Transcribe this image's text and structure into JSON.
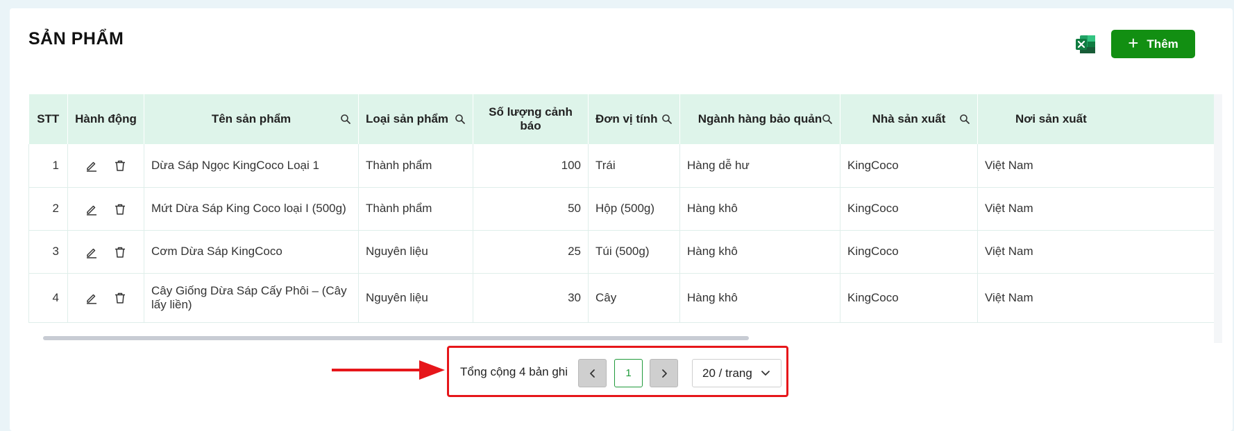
{
  "page": {
    "title": "SẢN PHẨM"
  },
  "toolbar": {
    "add_label": "Thêm"
  },
  "icons": {
    "excel": "excel-icon",
    "plus": "plus-icon",
    "search": "search-icon",
    "edit": "edit-icon",
    "delete": "trash-icon",
    "prev": "chevron-left-icon",
    "next": "chevron-right-icon",
    "dropdown": "chevron-down-icon",
    "arrow": "red-arrow-icon"
  },
  "colors": {
    "accent": "#128f12",
    "header_bg": "#def4ea",
    "highlight": "#e6161a"
  },
  "table": {
    "columns": {
      "stt": "STT",
      "actions": "Hành động",
      "name": "Tên sản phẩm",
      "type": "Loại sản phẩm",
      "warn_qty": "Số lượng cảnh báo",
      "unit": "Đơn vị tính",
      "storage": "Ngành hàng bảo quản",
      "maker": "Nhà sản xuất",
      "origin": "Nơi sản xuất"
    },
    "rows": [
      {
        "stt": "1",
        "name": "Dừa Sáp Ngọc KingCoco Loại 1",
        "type": "Thành phẩm",
        "warn_qty": "100",
        "unit": "Trái",
        "storage": "Hàng dễ hư",
        "maker": "KingCoco",
        "origin": "Việt Nam"
      },
      {
        "stt": "2",
        "name": "Mứt Dừa Sáp King Coco loại I (500g)",
        "type": "Thành phẩm",
        "warn_qty": "50",
        "unit": "Hộp (500g)",
        "storage": "Hàng khô",
        "maker": "KingCoco",
        "origin": "Việt Nam"
      },
      {
        "stt": "3",
        "name": "Cơm Dừa Sáp KingCoco",
        "type": "Nguyên liệu",
        "warn_qty": "25",
        "unit": "Túi (500g)",
        "storage": "Hàng khô",
        "maker": "KingCoco",
        "origin": "Việt Nam"
      },
      {
        "stt": "4",
        "name": "Cây Giống Dừa Sáp Cấy Phôi – (Cây lấy liền)",
        "type": "Nguyên liệu",
        "warn_qty": "30",
        "unit": "Cây",
        "storage": "Hàng khô",
        "maker": "KingCoco",
        "origin": "Việt Nam"
      }
    ]
  },
  "pagination": {
    "total_text": "Tổng cộng 4 bản ghi",
    "current_page": "1",
    "page_size": "20 / trang"
  }
}
